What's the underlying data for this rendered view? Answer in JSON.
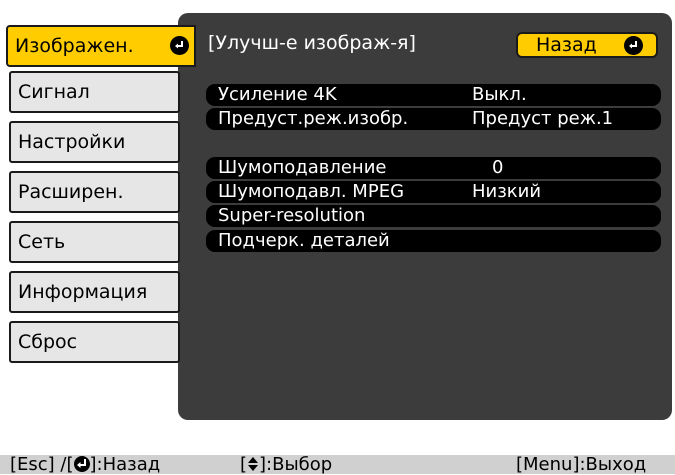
{
  "sidebar": {
    "items": [
      {
        "label": "Изображен."
      },
      {
        "label": "Сигнал"
      },
      {
        "label": "Настройки"
      },
      {
        "label": "Расширен."
      },
      {
        "label": "Сеть"
      },
      {
        "label": "Информация"
      },
      {
        "label": "Сброс"
      }
    ],
    "active_index": 0
  },
  "panel": {
    "title": "[Улучш-е изображ-я]",
    "back_label": "Назад",
    "group1": [
      {
        "label": "Усиление 4K",
        "value": "Выкл."
      },
      {
        "label": "Предуст.реж.изобр.",
        "value": "Предуст реж.1"
      }
    ],
    "group2": [
      {
        "label": "Шумоподавление",
        "value": "0"
      },
      {
        "label": "Шумоподавл. MPEG",
        "value": "Низкий"
      },
      {
        "label": "Super-resolution",
        "value": ""
      },
      {
        "label": "Подчерк. деталей",
        "value": ""
      }
    ]
  },
  "footer": {
    "esc_prefix": "[Esc] /[",
    "esc_suffix": "]:Назад",
    "select_prefix": "[",
    "select_suffix": "]:Выбор",
    "menu_exit": "[Menu]:Выход"
  },
  "colors": {
    "highlight": "#ffcc00",
    "panel_bg": "#3c3c3c",
    "row_bg": "#000000",
    "sidebar_bg": "#e6e6e6",
    "footer_bg": "#d0d0d0"
  },
  "icons": {
    "enter": "enter-icon",
    "updown": "updown-arrow-icon"
  }
}
